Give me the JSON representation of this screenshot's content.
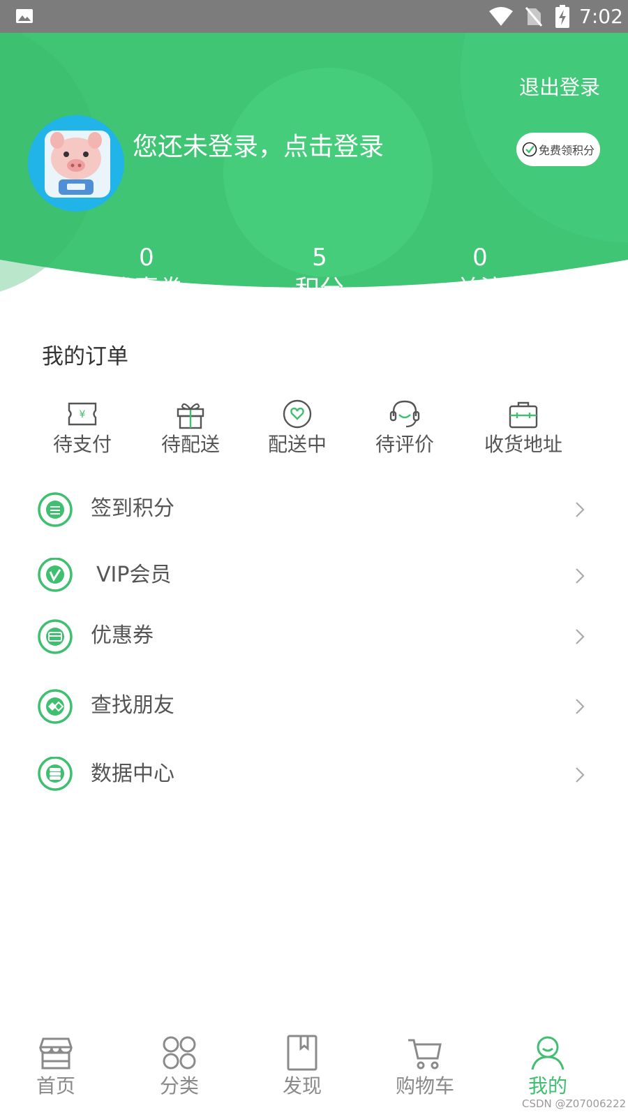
{
  "status_bar": {
    "time": "7:02",
    "icons": [
      "image-icon",
      "wifi-icon",
      "no-sim-icon",
      "battery-charging-icon"
    ]
  },
  "header": {
    "logout_label": "退出登录",
    "login_prompt": "您还未登录，点击登录",
    "free_points_label": "免费领积分",
    "stats": [
      {
        "value": "0",
        "label": "优惠券"
      },
      {
        "value": "5",
        "label": "积分"
      },
      {
        "value": "0",
        "label": "关注"
      }
    ]
  },
  "orders": {
    "title": "我的订单",
    "items": [
      {
        "label": "待支付",
        "icon": "yen-ticket-icon"
      },
      {
        "label": "待配送",
        "icon": "gift-icon"
      },
      {
        "label": "配送中",
        "icon": "heart-circle-icon"
      },
      {
        "label": "待评价",
        "icon": "headset-icon"
      },
      {
        "label": "收货地址",
        "icon": "briefcase-icon"
      }
    ]
  },
  "menu": {
    "items": [
      {
        "label": "签到积分",
        "icon": "coin-stack-icon"
      },
      {
        "label": "VIP会员",
        "icon": "vimeo-v-icon"
      },
      {
        "label": "优惠券",
        "icon": "card-icon"
      },
      {
        "label": "查找朋友",
        "icon": "diamond-eye-icon"
      },
      {
        "label": "数据中心",
        "icon": "database-icon"
      }
    ]
  },
  "bottom_nav": {
    "items": [
      {
        "label": "首页",
        "icon": "store-icon",
        "active": false
      },
      {
        "label": "分类",
        "icon": "category-grid-icon",
        "active": false
      },
      {
        "label": "发现",
        "icon": "bookmark-book-icon",
        "active": false
      },
      {
        "label": "购物车",
        "icon": "cart-icon",
        "active": false
      },
      {
        "label": "我的",
        "icon": "profile-icon",
        "active": true
      }
    ]
  },
  "watermark": "CSDN @Z07006222",
  "colors": {
    "brand_green": "#3fc574",
    "icon_green": "#3fbf6f",
    "status_bar": "#7c7c7c",
    "nav_gray": "#8a8a8a"
  }
}
